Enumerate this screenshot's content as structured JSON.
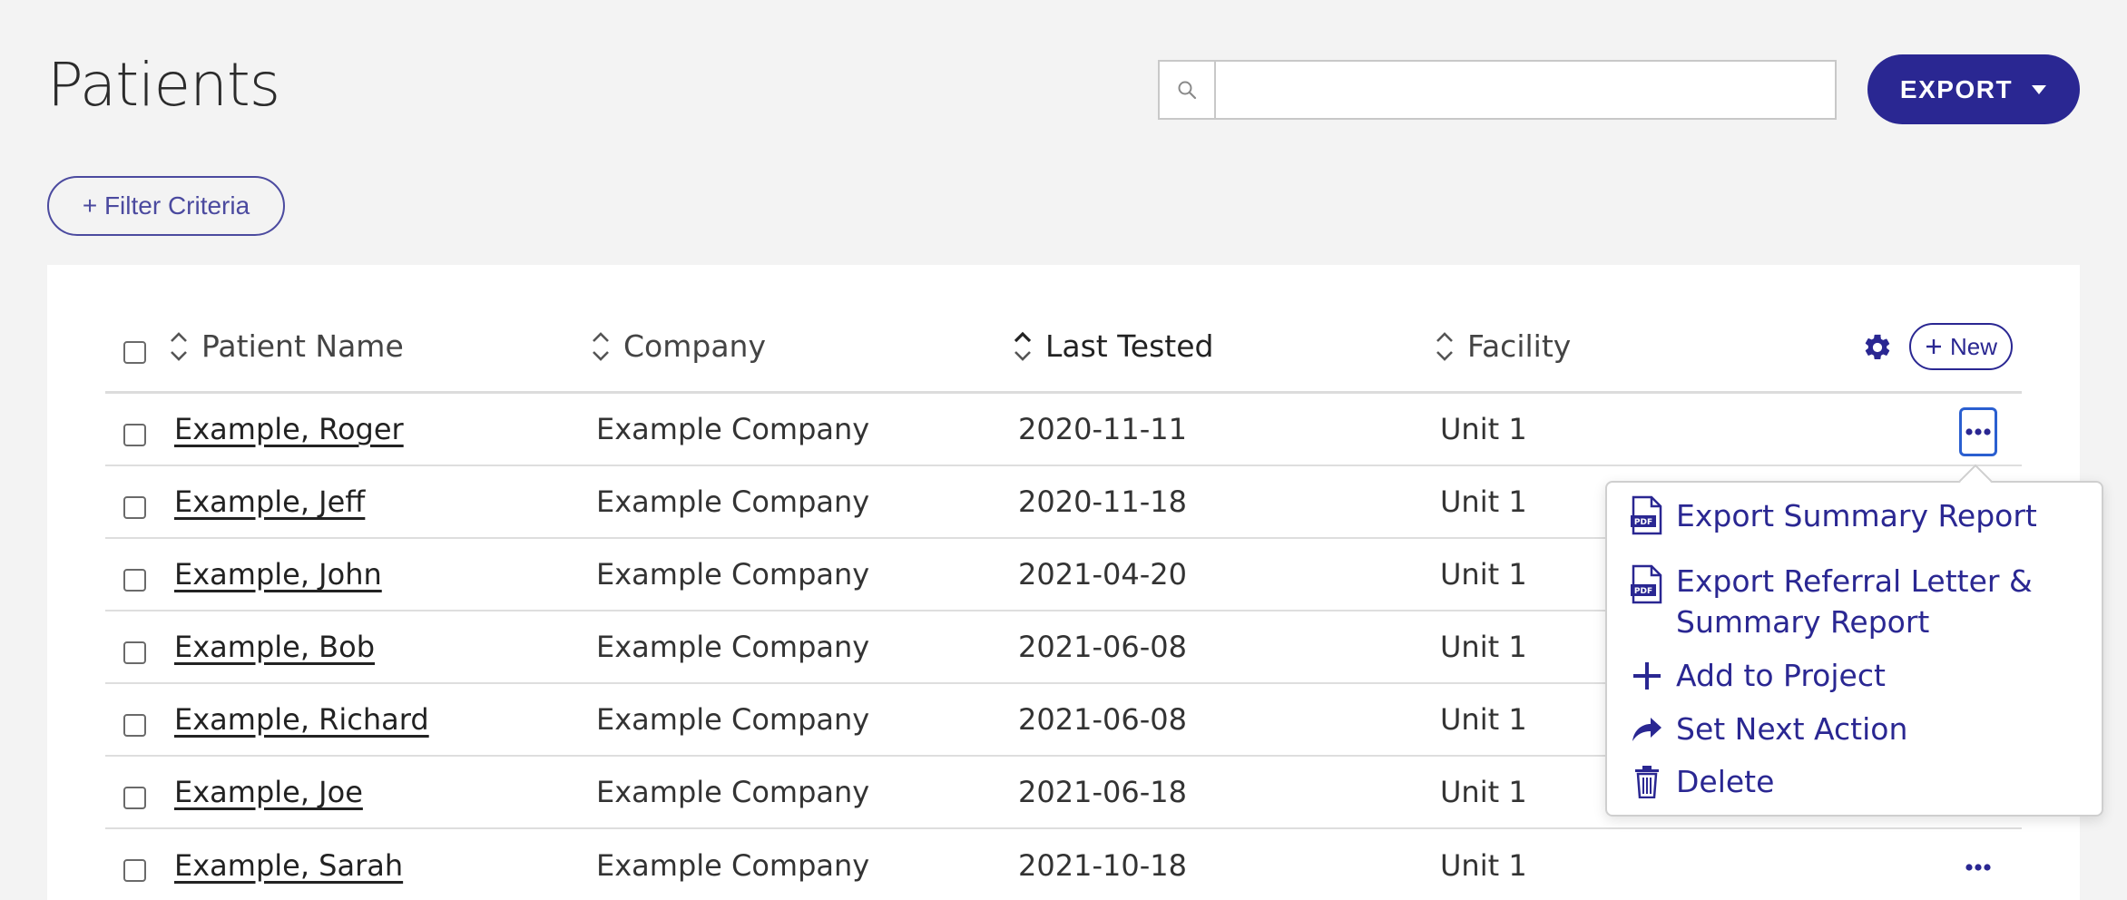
{
  "page": {
    "title": "Patients"
  },
  "search": {
    "placeholder": "",
    "value": ""
  },
  "toolbar": {
    "export_label": "EXPORT",
    "filter_label": "+ Filter Criteria"
  },
  "table": {
    "columns": [
      "Patient Name",
      "Company",
      "Last Tested",
      "Facility"
    ],
    "new_label": "New",
    "rows": [
      {
        "name": "Example, Roger",
        "company": "Example Company",
        "last_tested": "2020-11-11",
        "facility": "Unit 1"
      },
      {
        "name": "Example, Jeff",
        "company": "Example Company",
        "last_tested": "2020-11-18",
        "facility": "Unit 1"
      },
      {
        "name": "Example, John",
        "company": "Example Company",
        "last_tested": "2021-04-20",
        "facility": "Unit 1"
      },
      {
        "name": "Example, Bob",
        "company": "Example Company",
        "last_tested": "2021-06-08",
        "facility": "Unit 1"
      },
      {
        "name": "Example, Richard",
        "company": "Example Company",
        "last_tested": "2021-06-08",
        "facility": "Unit 1"
      },
      {
        "name": "Example, Joe",
        "company": "Example Company",
        "last_tested": "2021-06-18",
        "facility": "Unit 1"
      },
      {
        "name": "Example, Sarah",
        "company": "Example Company",
        "last_tested": "2021-10-18",
        "facility": "Unit 1"
      }
    ]
  },
  "row_menu": {
    "items": [
      {
        "label": "Export Summary Report",
        "icon": "pdf-icon"
      },
      {
        "label_line1": "Export Referral Letter &",
        "label_line2": "Summary Report",
        "icon": "pdf-icon"
      },
      {
        "label": "Add to Project",
        "icon": "plus-icon"
      },
      {
        "label": "Set Next Action",
        "icon": "forward-arrow-icon"
      },
      {
        "label": "Delete",
        "icon": "trash-icon"
      }
    ]
  },
  "colors": {
    "accent": "#2a2792",
    "focus": "#2a5fd0",
    "background": "#f3f3f3"
  }
}
